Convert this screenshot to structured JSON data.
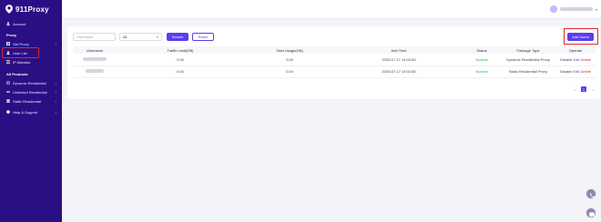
{
  "brand": {
    "name": "911Proxy"
  },
  "sidebar": {
    "account": "Account",
    "section_proxy": "Proxy",
    "get_proxy": "Get Proxy",
    "user_list": "User List",
    "ip_allowlist": "IP Allowlist",
    "section_products": "All Products",
    "products": [
      "Dynamic Residential",
      "Unlimited Residential",
      "Static Residential"
    ],
    "help": "Help & Support"
  },
  "filters": {
    "username_placeholder": "Username",
    "status_value": "All",
    "search_label": "Search",
    "reset_label": "Reset"
  },
  "add_users_label": "Add Users",
  "table": {
    "headers": [
      "Username",
      "Traffic Limit(GB)",
      "Total Usage(GB)",
      "Add Time",
      "Status",
      "Package Type",
      "Operate"
    ],
    "rows": [
      {
        "traffic_limit": "0.00",
        "total_usage": "0.00",
        "add_time": "2025-07-17 14:02:55",
        "status": "Normal",
        "package_type": "Dynamic Residential Proxy",
        "op_disable": "Disable",
        "op_edit": "Edit",
        "op_delete": "Delete"
      },
      {
        "traffic_limit": "0.00",
        "total_usage": "0.00",
        "add_time": "2025-07-17 14:02:55",
        "status": "Normal",
        "package_type": "Static Residential Proxy",
        "op_disable": "Disable",
        "op_edit": "Edit",
        "op_delete": "Delete"
      }
    ]
  },
  "pagination": {
    "prev": "<",
    "current": "1",
    "next": ">"
  },
  "colors": {
    "sidebar": "#2a0f84",
    "accent": "#5b3df0",
    "highlight": "#e0262e",
    "status_ok": "#2aa86a"
  }
}
